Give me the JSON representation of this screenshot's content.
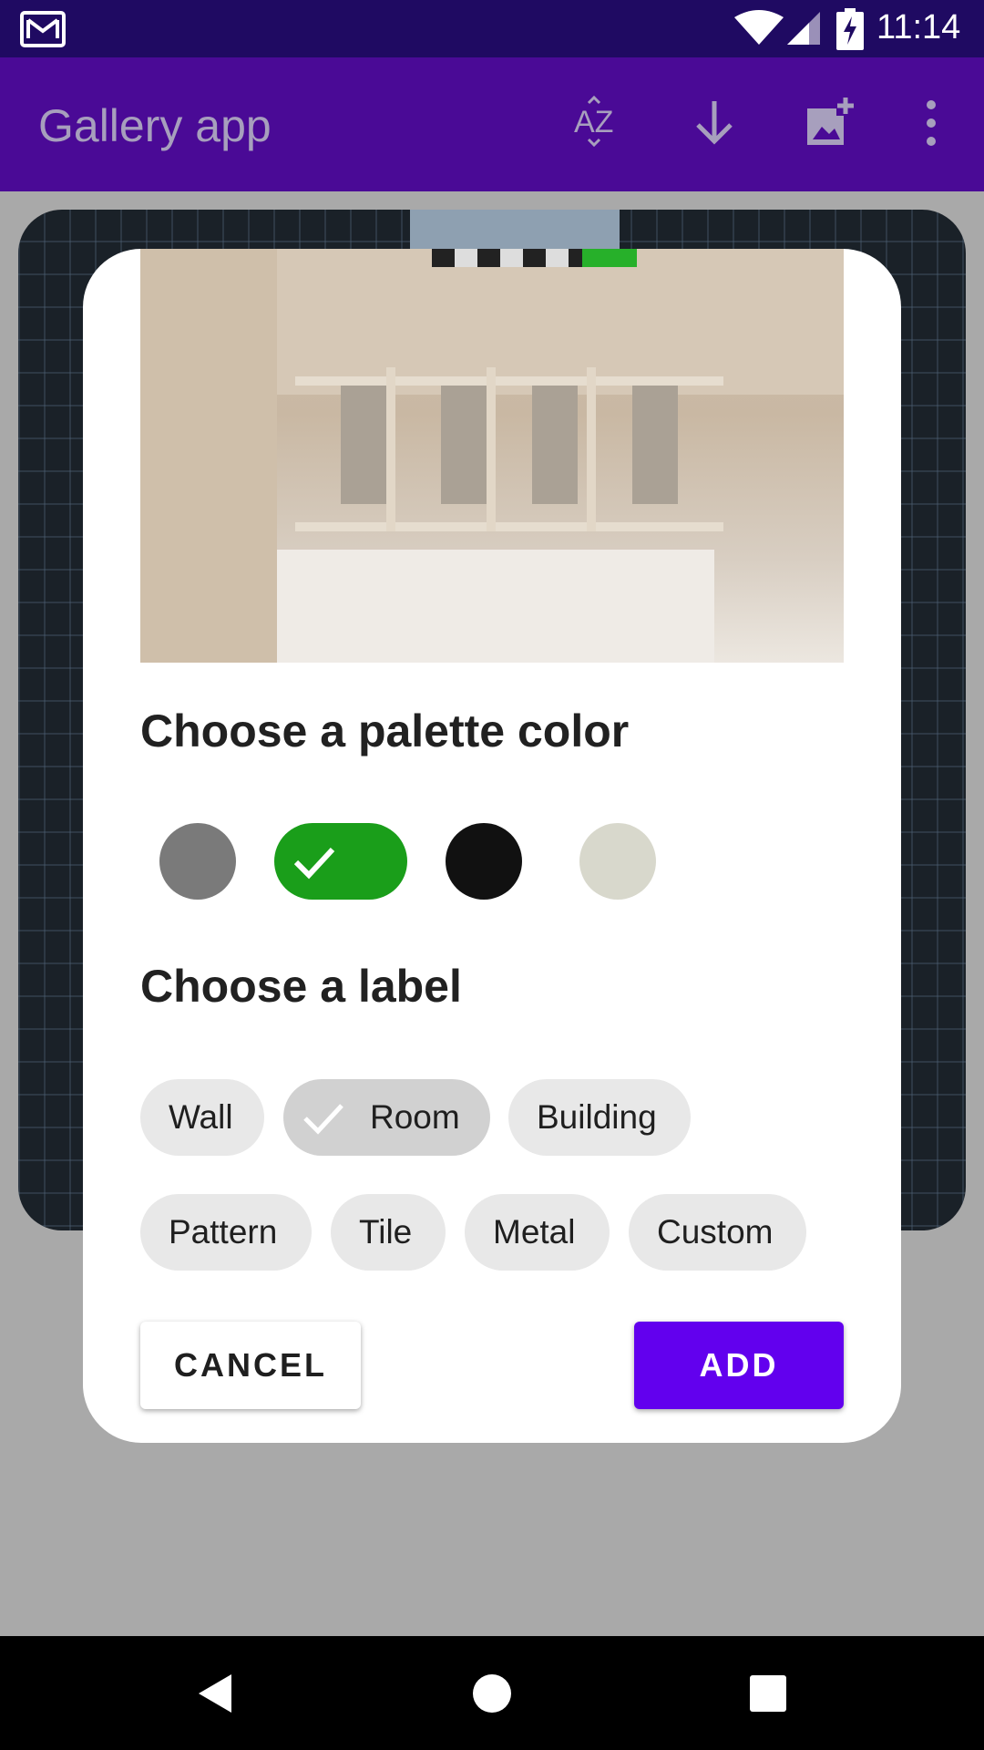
{
  "status_bar": {
    "time": "11:14",
    "icons": [
      "gmail-icon",
      "wifi-icon",
      "signal-icon",
      "battery-charging-icon"
    ]
  },
  "app_bar": {
    "title": "Gallery app",
    "actions": [
      "sort-az-icon",
      "download-icon",
      "add-photo-icon",
      "more-vert-icon"
    ]
  },
  "dialog": {
    "palette_title": "Choose a palette color",
    "palette_colors": [
      {
        "color": "#7a7a7a",
        "selected": false
      },
      {
        "color": "#1a9e1a",
        "selected": true
      },
      {
        "color": "#111111",
        "selected": false
      },
      {
        "color": "#d8d8cc",
        "selected": false
      }
    ],
    "label_title": "Choose a label",
    "labels": [
      {
        "text": "Wall",
        "selected": false
      },
      {
        "text": "Room",
        "selected": true
      },
      {
        "text": "Building",
        "selected": false
      },
      {
        "text": "Pattern",
        "selected": false
      },
      {
        "text": "Tile",
        "selected": false
      },
      {
        "text": "Metal",
        "selected": false
      },
      {
        "text": "Custom",
        "selected": false
      }
    ],
    "cancel_label": "CANCEL",
    "add_label": "ADD"
  },
  "colors": {
    "accent": "#6200ee",
    "status_bar": "#1f0a62",
    "app_bar_dimmed": "#4a0a96"
  },
  "nav_bar": {
    "icons": [
      "back-icon",
      "home-icon",
      "recents-icon"
    ]
  }
}
